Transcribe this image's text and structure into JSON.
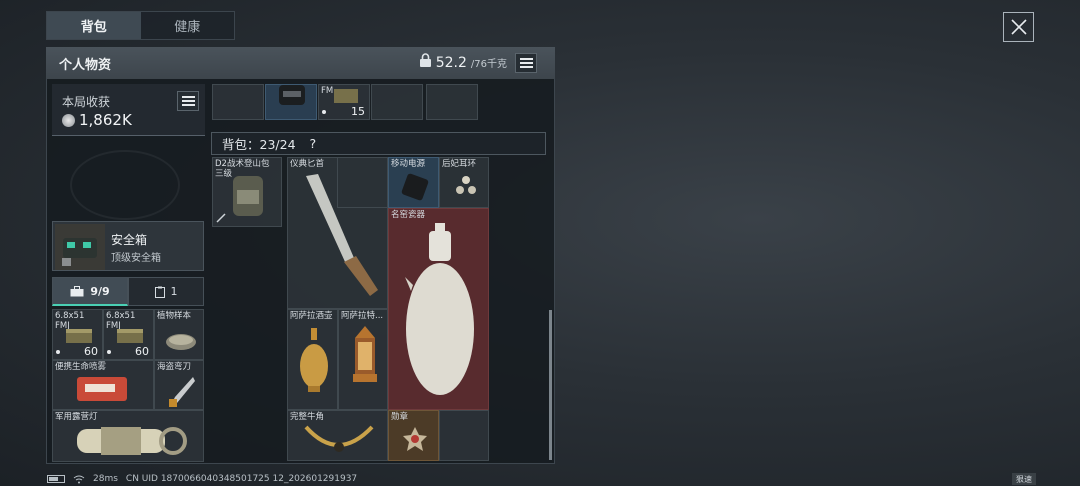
{
  "tabs": [
    {
      "label": "背包"
    },
    {
      "label": "健康"
    }
  ],
  "panel": {
    "title": "个人物资",
    "weight_current": "52.2",
    "weight_max": "/76千克"
  },
  "harvest": {
    "label": "本局收获",
    "value": "1,862K"
  },
  "safebox": {
    "title": "安全箱",
    "subtitle": "顶级安全箱"
  },
  "subtabs": [
    {
      "label": "9/9"
    },
    {
      "label": "1"
    }
  ],
  "pocket_items": [
    {
      "name": "6.8x51\nFMJ",
      "qty": "60"
    },
    {
      "name": "6.8x51\nFMJ",
      "qty": "60"
    },
    {
      "name": "植物样本",
      "qty": ""
    },
    {
      "name": "便携生命喷雾",
      "qty": ""
    },
    {
      "name": "海盗弯刀",
      "qty": ""
    },
    {
      "name": "军用露营灯",
      "qty": ""
    }
  ],
  "top_strip": {
    "qty": "15",
    "label": "FM"
  },
  "backpack": {
    "capacity_label": "背包：23/24",
    "help": "?",
    "bag_name": "D2战术登山包\n三级",
    "items": [
      {
        "name": "仪典匕首"
      },
      {
        "name": "移动电源"
      },
      {
        "name": "后妃耳环"
      },
      {
        "name": "名窑瓷器"
      },
      {
        "name": "阿萨拉酒壶"
      },
      {
        "name": "阿萨拉特..."
      },
      {
        "name": "完整牛角"
      },
      {
        "name": "勋章"
      }
    ]
  },
  "status": {
    "ping": "28ms",
    "uid": "CN UID 1870066040348501725 12_202601291937"
  },
  "speed_label": "狠速"
}
